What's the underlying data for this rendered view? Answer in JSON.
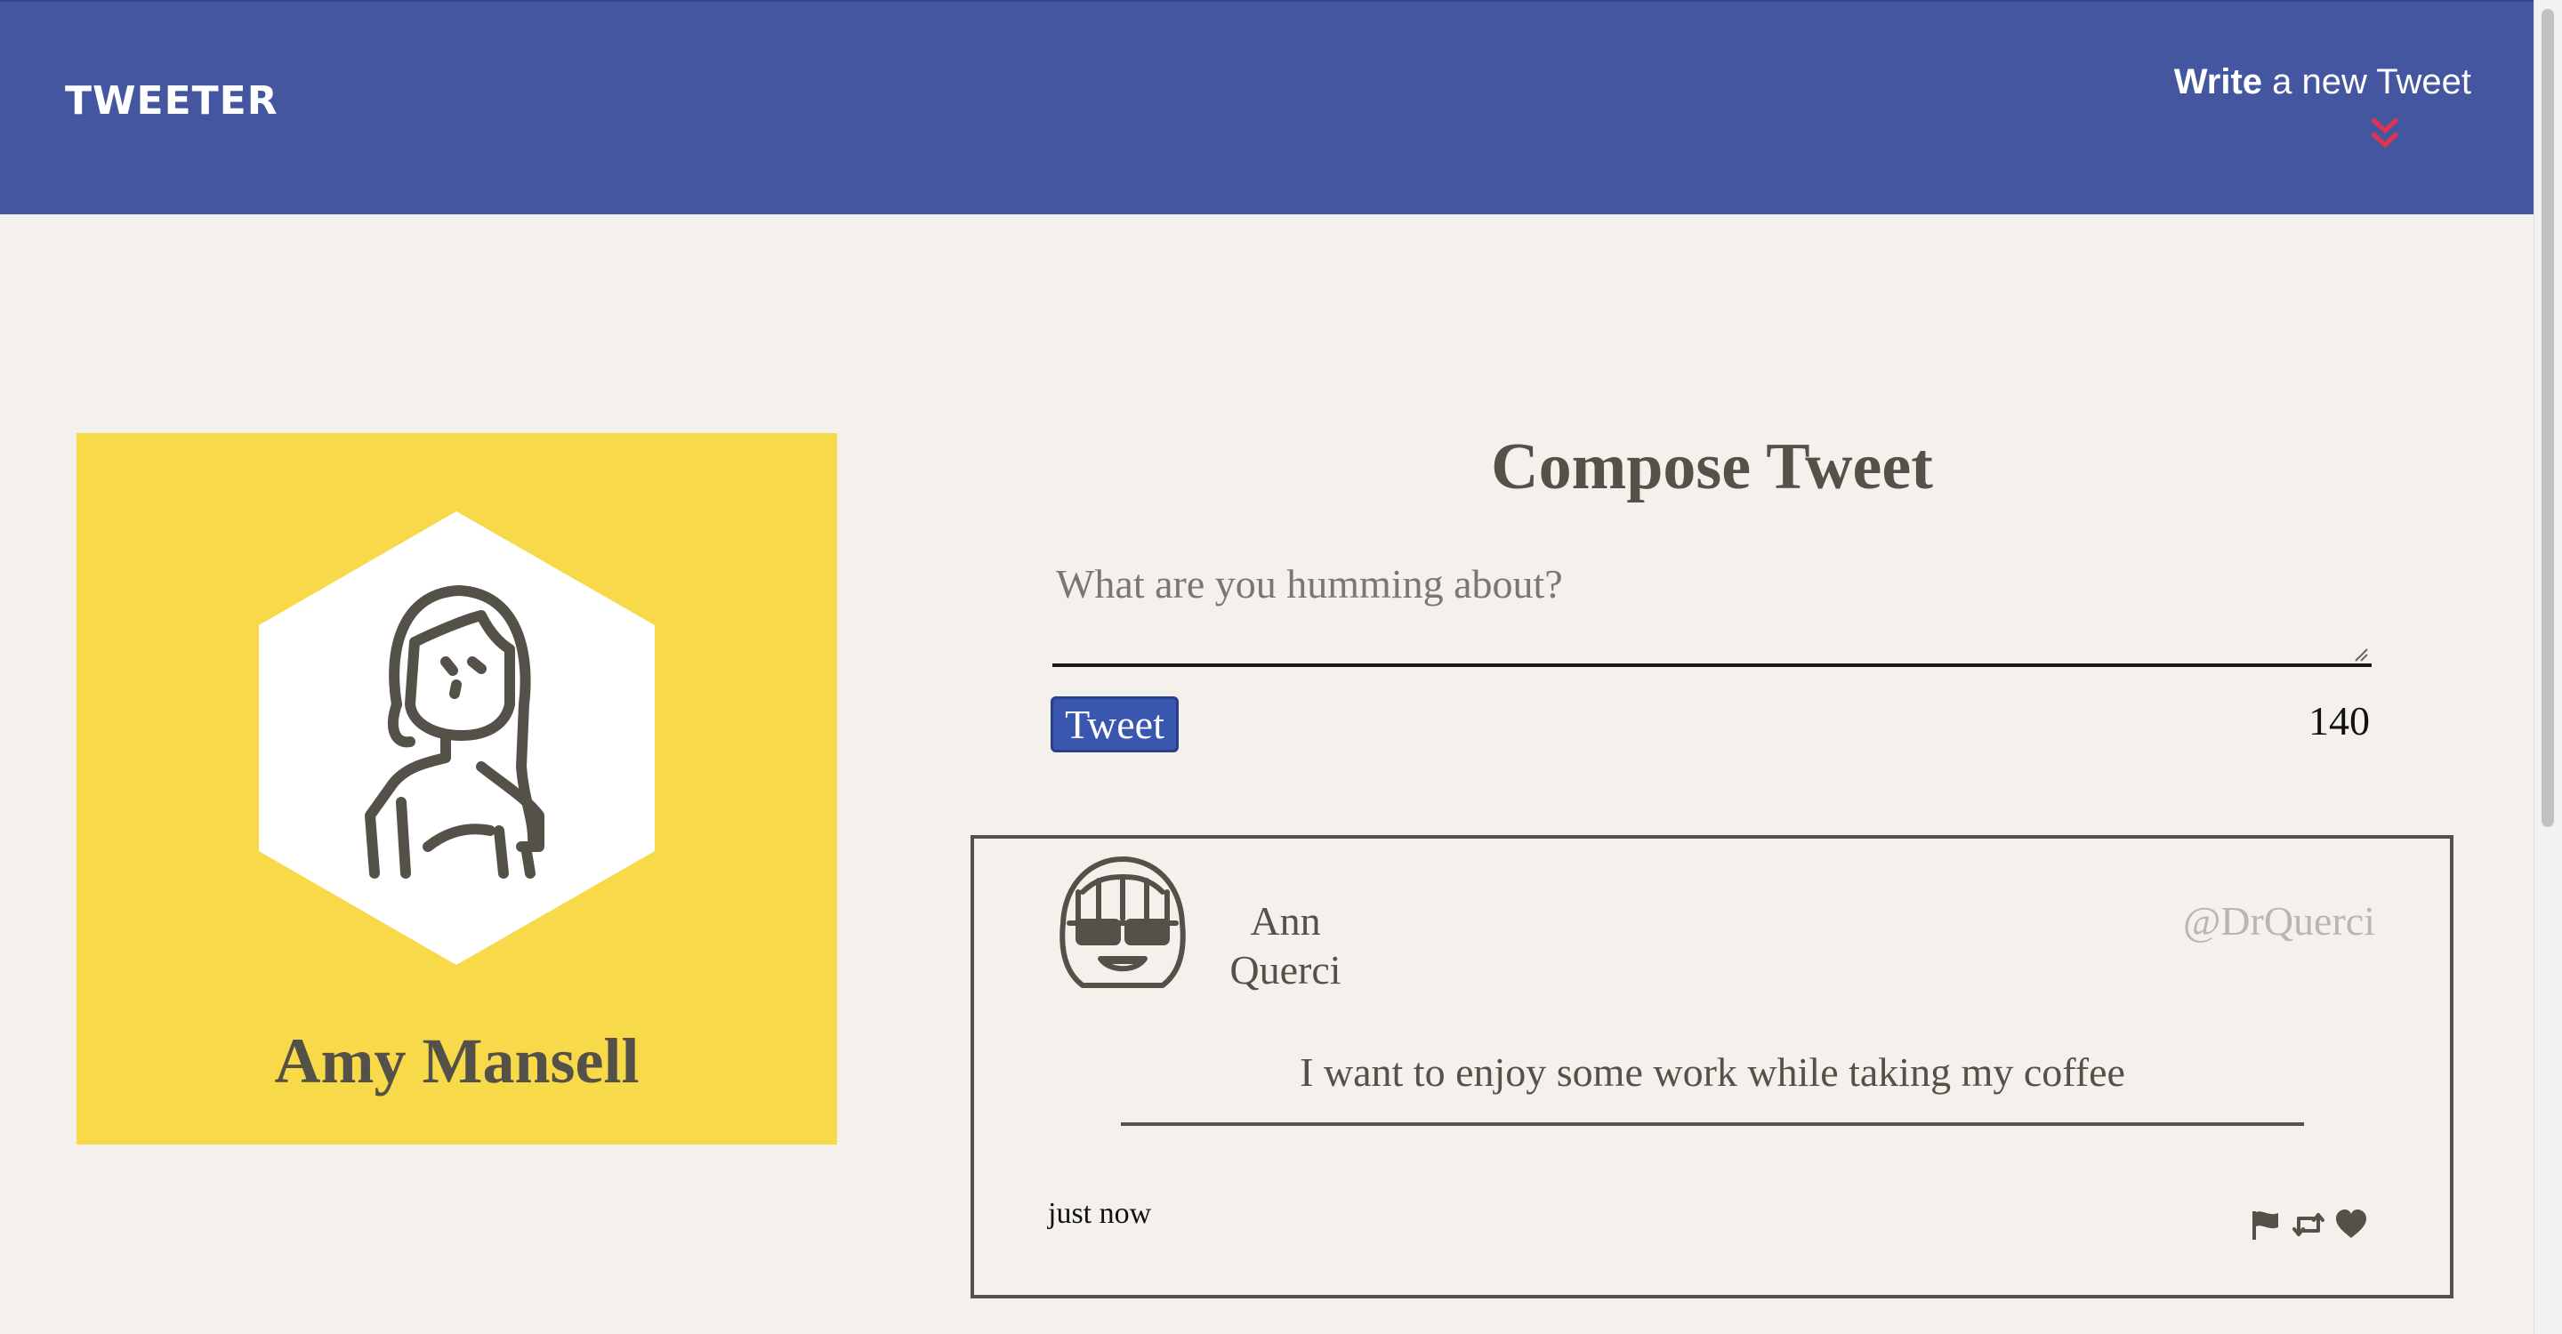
{
  "header": {
    "logo": "TWEETER",
    "compose_toggle": {
      "bold_text": "Write",
      "rest_text": " a new Tweet",
      "icon": "chevron-double-down-icon",
      "icon_color": "#e0334e"
    },
    "background_color": "#4556a0"
  },
  "profile": {
    "name": "Amy Mansell",
    "avatar_icon": "woman-avatar-icon",
    "background_color": "#f8d94a"
  },
  "compose": {
    "title": "Compose Tweet",
    "placeholder": "What are you humming about?",
    "value": "",
    "submit_label": "Tweet",
    "char_counter": "140"
  },
  "tweets": [
    {
      "avatar_icon": "glasses-avatar-icon",
      "author_first": "Ann",
      "author_last": "Querci",
      "handle": "@DrQuerci",
      "content": "I want to enjoy some work while taking my coffee",
      "time": "just now",
      "actions": [
        "flag-icon",
        "retweet-icon",
        "heart-icon"
      ]
    }
  ]
}
